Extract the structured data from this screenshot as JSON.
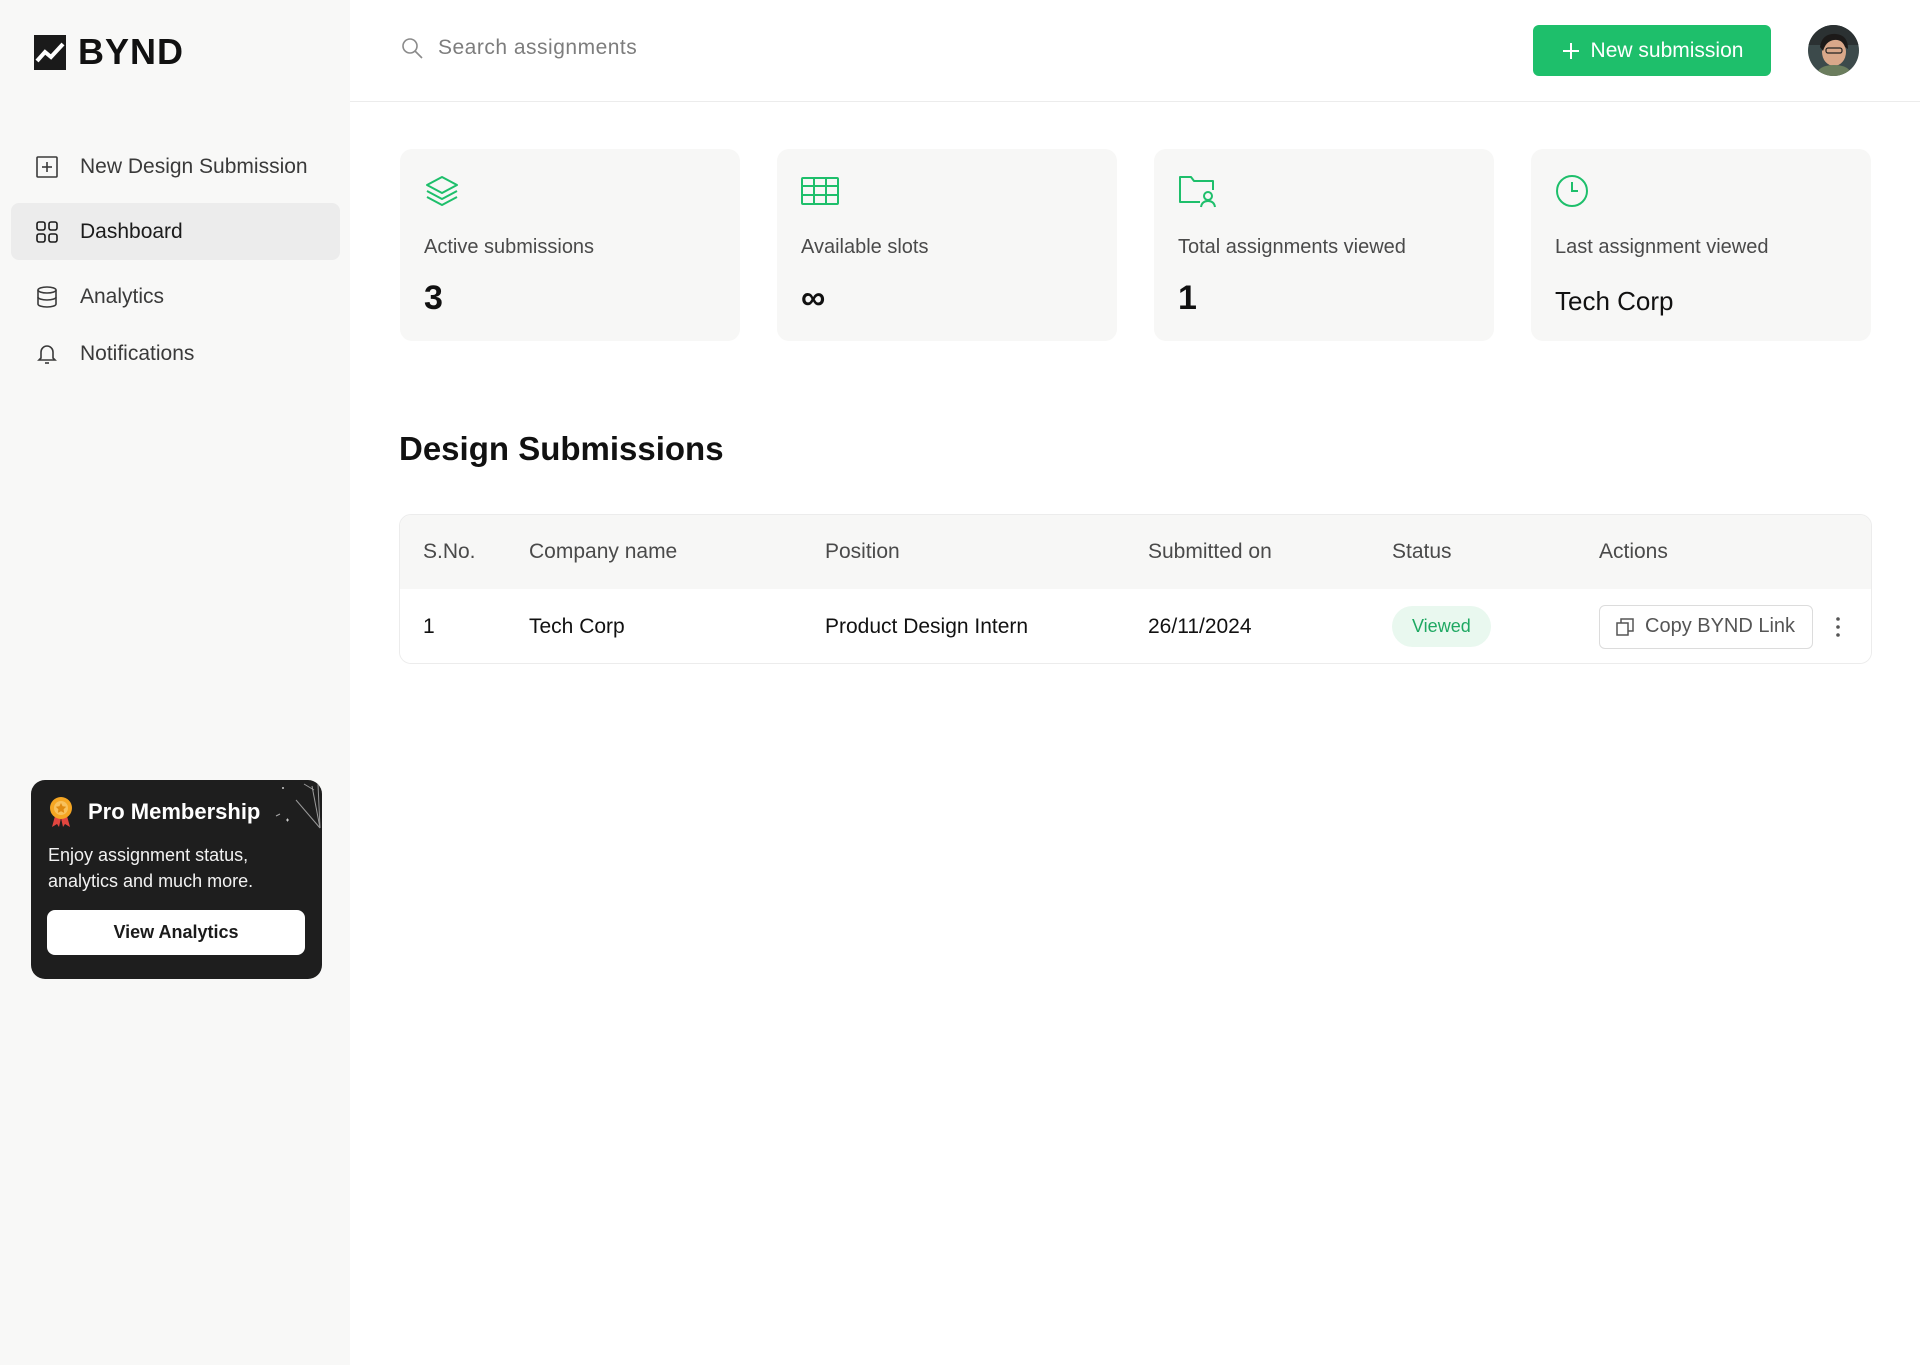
{
  "brand": {
    "name": "BYND",
    "accent": "#1EBF6B"
  },
  "sidebar": {
    "items": [
      {
        "label": "New Design Submission",
        "icon": "plus-square-icon"
      },
      {
        "label": "Dashboard",
        "icon": "grid-icon",
        "active": true
      },
      {
        "label": "Analytics",
        "icon": "database-icon"
      },
      {
        "label": "Notifications",
        "icon": "bell-icon"
      }
    ],
    "promo": {
      "title": "Pro Membership",
      "text": "Enjoy assignment status, analytics and much more.",
      "button": "View Analytics"
    }
  },
  "header": {
    "search_placeholder": "Search assignments",
    "new_button": "New submission"
  },
  "stats": [
    {
      "label": "Active submissions",
      "value": "3",
      "icon": "layers-icon"
    },
    {
      "label": "Available slots",
      "value": "∞",
      "icon": "table-icon"
    },
    {
      "label": "Total assignments viewed",
      "value": "1",
      "icon": "folder-user-icon"
    },
    {
      "label": "Last assignment viewed",
      "value": "Tech Corp",
      "icon": "clock-icon"
    }
  ],
  "section": {
    "title": "Design Submissions"
  },
  "table": {
    "columns": [
      "S.No.",
      "Company name",
      "Position",
      "Submitted on",
      "Status",
      "Actions"
    ],
    "rows": [
      {
        "sno": "1",
        "company": "Tech Corp",
        "position": "Product Design Intern",
        "submitted": "26/11/2024",
        "status": "Viewed",
        "action": "Copy BYND Link"
      }
    ]
  }
}
